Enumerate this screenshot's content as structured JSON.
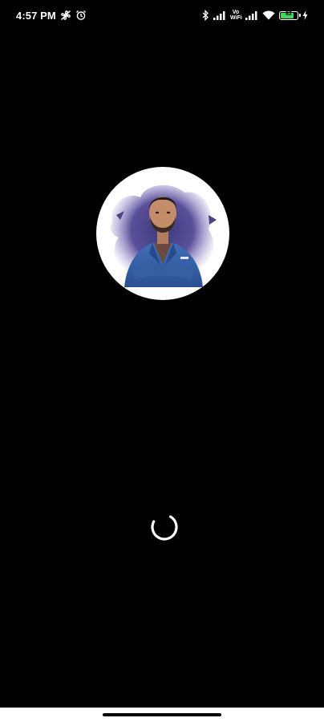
{
  "status_bar": {
    "time": "4:57 PM",
    "left_icons": [
      "fan-icon",
      "alarm-icon"
    ],
    "right_icons": [
      "bluetooth-icon",
      "signal-icon",
      "volte-icon",
      "signal-icon",
      "wifi-icon",
      "battery-icon",
      "charging-icon"
    ],
    "volte_label_top": "Vo",
    "volte_label_bottom": "WiFi",
    "battery_level": 0.82,
    "battery_text": "82",
    "battery_color": "#3ddc55"
  },
  "splash": {
    "logo": "profile-avatar",
    "background_color": "#000000"
  },
  "loader": {
    "type": "spinner-icon"
  }
}
